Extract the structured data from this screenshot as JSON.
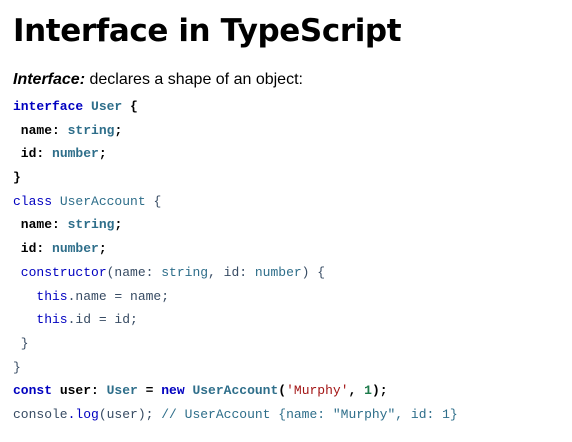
{
  "page": {
    "title": "Interface in TypeScript",
    "description": {
      "term": "Interface:",
      "text": " declares a shape of an object:"
    }
  },
  "code": {
    "l1": {
      "kw": "interface",
      "name": "User",
      "brace": " {"
    },
    "l2": {
      "prop": " name:",
      "type": "string",
      "semi": ";"
    },
    "l3": {
      "prop": " id:",
      "type": "number",
      "semi": ";"
    },
    "l4": {
      "brace": "}"
    },
    "l5": {
      "kw": "class",
      "name": "UserAccount",
      "brace": " {"
    },
    "l6": {
      "prop": " name:",
      "type": "string",
      "semi": ";"
    },
    "l7": {
      "prop": " id:",
      "type": "number",
      "semi": ";"
    },
    "l8": {
      "fn": " constructor",
      "p1": "(name: ",
      "t1": "string",
      "p2": ", id: ",
      "t2": "number",
      "p3": ") {"
    },
    "l9": {
      "kw": "   this",
      "rest": ".name = name;"
    },
    "l10": {
      "kw": "   this",
      "rest": ".id = id;"
    },
    "l11": {
      "brace": " }"
    },
    "l12": {
      "brace": "}"
    },
    "l13": {
      "kw": "const",
      "v": " user: ",
      "type": "User",
      "eq": " = ",
      "kw2": "new",
      "cls": " UserAccount",
      "p1": "(",
      "str": "'Murphy'",
      "p2": ", ",
      "num": "1",
      "p3": ");"
    },
    "l14": {
      "obj": "console",
      "fn": ".log",
      "p1": "(user); ",
      "comment": "// UserAccount {name: \"Murphy\", id: 1}"
    }
  }
}
